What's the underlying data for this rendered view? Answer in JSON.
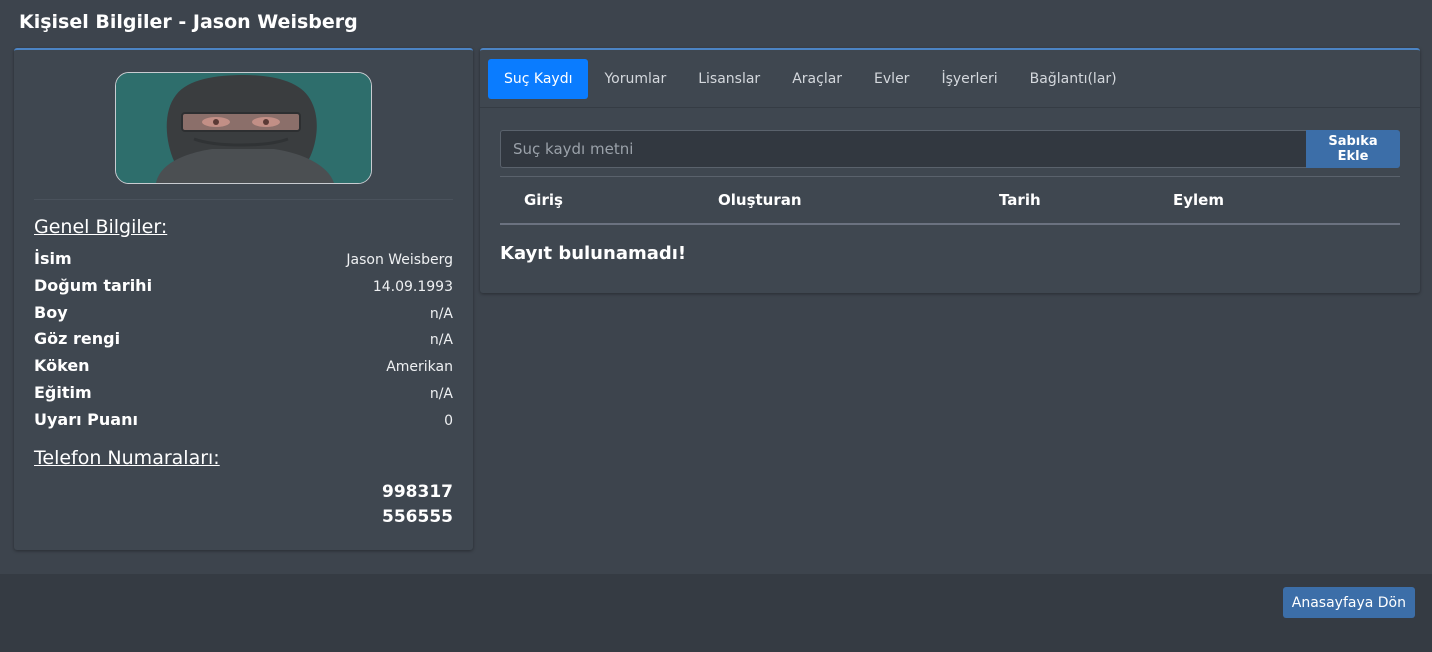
{
  "page": {
    "title": "Kişisel Bilgiler - Jason Weisberg"
  },
  "profile": {
    "general_title": "Genel Bilgiler:",
    "fields": [
      {
        "label": "İsim",
        "value": "Jason Weisberg"
      },
      {
        "label": "Doğum tarihi",
        "value": "14.09.1993"
      },
      {
        "label": "Boy",
        "value": "n/A"
      },
      {
        "label": "Göz rengi",
        "value": "n/A"
      },
      {
        "label": "Köken",
        "value": "Amerikan"
      },
      {
        "label": "Eğitim",
        "value": "n/A"
      },
      {
        "label": "Uyarı Puanı",
        "value": "0"
      }
    ],
    "phones_title": "Telefon Numaraları:",
    "phones": [
      "998317",
      "556555"
    ]
  },
  "tabs": [
    {
      "label": "Suç Kaydı",
      "active": true
    },
    {
      "label": "Yorumlar"
    },
    {
      "label": "Lisanslar"
    },
    {
      "label": "Araçlar"
    },
    {
      "label": "Evler"
    },
    {
      "label": "İşyerleri"
    },
    {
      "label": "Bağlantı(lar)"
    }
  ],
  "record": {
    "input_placeholder": "Suç kaydı metni",
    "add_button": "Sabıka Ekle",
    "columns": [
      "Giriş",
      "Oluşturan",
      "Tarih",
      "Eylem"
    ],
    "empty_message": "Kayıt bulunamadı!"
  },
  "footer": {
    "home_button": "Anasayfaya Dön"
  },
  "colors": {
    "background": "#3d444d",
    "card": "#3f4750",
    "accent_border": "#4c84c4",
    "active_tab": "#0a7cff",
    "button": "#3c6ea8"
  }
}
